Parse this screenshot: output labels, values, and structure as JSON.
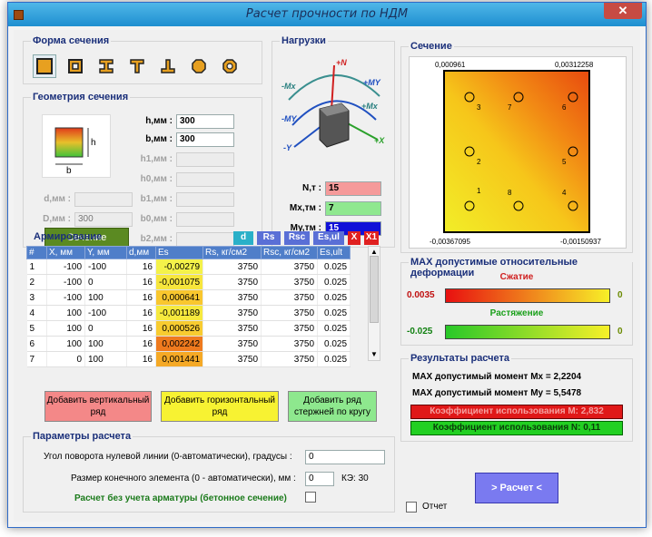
{
  "window": {
    "title": "Расчет прочности по НДМ",
    "close": "✕"
  },
  "shape_group": {
    "title": "Форма сечения",
    "shapes": [
      "rectangle-icon",
      "box-section-icon",
      "i-beam-icon",
      "t-section-icon",
      "inverted-t-icon",
      "circle-icon",
      "ring-icon"
    ]
  },
  "geometry": {
    "title": "Геометрия сечения",
    "h_label": "h,мм :",
    "h_value": "300",
    "b_label": "b,мм :",
    "b_value": "300",
    "h1_label": "h1,мм :",
    "h0_label": "h0,мм :",
    "d_label": "d,мм :",
    "b1_label": "b1,мм :",
    "D_label": "D,мм :",
    "D_value": "300",
    "b0_label": "b0,мм :",
    "b2_label": "b2,мм :",
    "preview_h": "h",
    "preview_b": "b",
    "section_button": "Сечение"
  },
  "loads": {
    "title": "Нагрузки",
    "N_label": "N,т :",
    "N_value": "15",
    "Mx_label": "Mx,тм :",
    "Mx_value": "7",
    "My_label": "My,тм :",
    "My_value": "15",
    "diagram_labels": {
      "plus_n": "+N",
      "minus_mx": "-Mx",
      "plus_my": "+MY",
      "minus_my": "-MY",
      "plus_mx": "+Mx",
      "minus_y": "-Y",
      "plus_x": "+X"
    }
  },
  "section_view": {
    "title": "Сечение",
    "top_left": "0,000961",
    "top_right": "0,00312258",
    "bottom_left": "-0,00367095",
    "bottom_right": "-0,00150937",
    "bars": [
      {
        "label": "3"
      },
      {
        "label": "7"
      },
      {
        "label": "6"
      },
      {
        "label": "2"
      },
      {
        "label": "5"
      },
      {
        "label": "1"
      },
      {
        "label": "8"
      },
      {
        "label": "4"
      }
    ]
  },
  "reinforcement": {
    "title": "Армирование",
    "tags": [
      "d",
      "Rs",
      "Rsc",
      "Es,ul",
      "X",
      "X1"
    ],
    "columns": [
      "#",
      "X, мм",
      "Y, мм",
      "d,мм",
      "Es",
      "Rs, кг/см2",
      "Rsc, кг/см2",
      "Es,ult"
    ],
    "rows": [
      {
        "n": "1",
        "x": "-100",
        "y": "-100",
        "d": "16",
        "es": "-0,00279",
        "rs": "3750",
        "rsc": "3750",
        "ult": "0.025",
        "color": "#f4f24a"
      },
      {
        "n": "2",
        "x": "-100",
        "y": "0",
        "d": "16",
        "es": "-0,001075",
        "rs": "3750",
        "rsc": "3750",
        "ult": "0.025",
        "color": "#f7e63c"
      },
      {
        "n": "3",
        "x": "-100",
        "y": "100",
        "d": "16",
        "es": "0,000641",
        "rs": "3750",
        "rsc": "3750",
        "ult": "0.025",
        "color": "#f9c72e"
      },
      {
        "n": "4",
        "x": "100",
        "y": "-100",
        "d": "16",
        "es": "-0,001189",
        "rs": "3750",
        "rsc": "3750",
        "ult": "0.025",
        "color": "#f6e93e"
      },
      {
        "n": "5",
        "x": "100",
        "y": "0",
        "d": "16",
        "es": "0,000526",
        "rs": "3750",
        "rsc": "3750",
        "ult": "0.025",
        "color": "#f8cc30"
      },
      {
        "n": "6",
        "x": "100",
        "y": "100",
        "d": "16",
        "es": "0,002242",
        "rs": "3750",
        "rsc": "3750",
        "ult": "0.025",
        "color": "#ef7a1e"
      },
      {
        "n": "7",
        "x": "0",
        "y": "100",
        "d": "16",
        "es": "0,001441",
        "rs": "3750",
        "rsc": "3750",
        "ult": "0.025",
        "color": "#f5a926"
      }
    ],
    "add_vertical": "Добавить вертикальный ряд",
    "add_horizontal": "Добавить горизонтальный ряд",
    "add_circle": "Добавить ряд стержней по кругу"
  },
  "deformations": {
    "title": "MAX допустимые относительные деформации",
    "compression_label": "Сжатие",
    "compression_value": "0.0035",
    "compression_zero": "0",
    "tension_label": "Растяжение",
    "tension_value": "-0.025",
    "tension_zero": "0"
  },
  "results": {
    "title": "Результаты расчета",
    "mx": "MAX допустимый момент Mx = 2,2204",
    "my": "MAX допустимый момент My = 5,5478",
    "util_m": "Коэффициент использования M: 2,832",
    "util_n": "Коэффициент использования N: 0,11"
  },
  "params": {
    "title": "Параметры расчета",
    "angle_label": "Угол поворота нулевой линии (0-автоматически), градусы :",
    "angle_value": "0",
    "size_label": "Размер конечного элемента (0 - автоматически), мм :",
    "size_value": "0",
    "fe_label": "КЭ: 30",
    "no_rebar_label": "Расчет без учета арматуры (бетонное сечение)"
  },
  "actions": {
    "calculate": "> Расчет <",
    "report": "Отчет"
  },
  "colors": {
    "accent": "#4f7ec9",
    "danger": "#e02020",
    "ok": "#22cc22"
  }
}
